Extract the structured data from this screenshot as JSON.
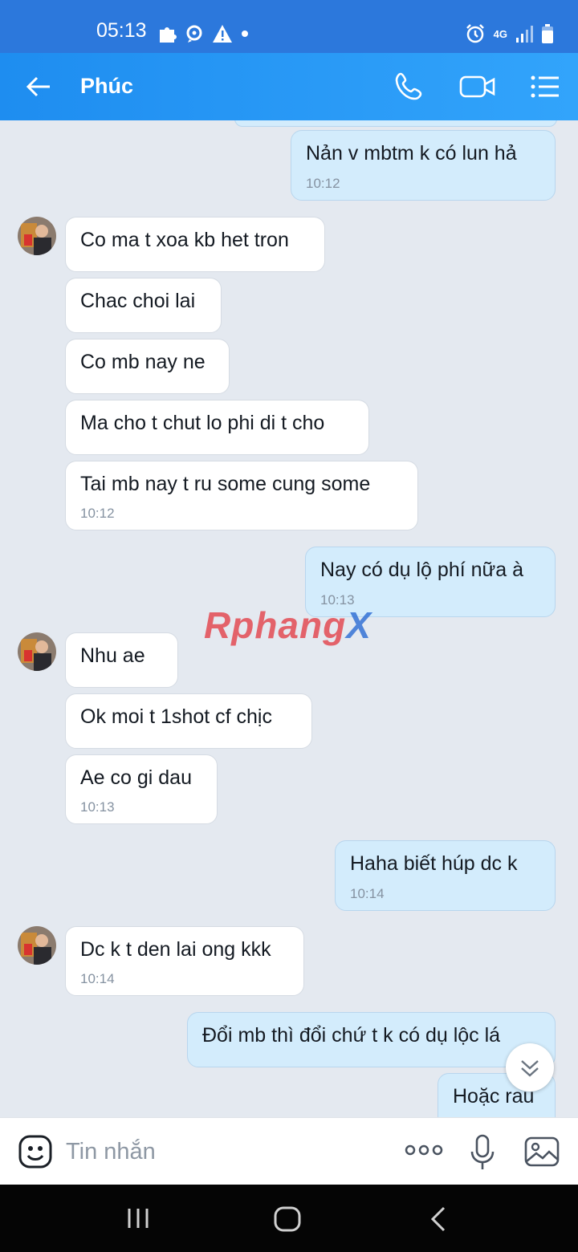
{
  "status": {
    "time": "05:13",
    "network": "4G"
  },
  "header": {
    "contact_name": "Phúc"
  },
  "messages": [
    {
      "text": "Nản v mbtm k có lun hả",
      "time": "10:12"
    },
    {
      "text": "Co ma t xoa kb het tron"
    },
    {
      "text": "Chac choi lai"
    },
    {
      "text": "Co mb nay ne"
    },
    {
      "text": "Ma cho t chut lo phi di t cho"
    },
    {
      "text": "Tai mb nay t ru some cung some",
      "time": "10:12"
    },
    {
      "text": "Nay có dụ lộ phí nữa à",
      "time": "10:13"
    },
    {
      "text": "Nhu ae"
    },
    {
      "text": "Ok moi t 1shot cf chịc"
    },
    {
      "text": "Ae co gi dau",
      "time": "10:13"
    },
    {
      "text": "Haha biết húp dc k",
      "time": "10:14"
    },
    {
      "text": "Dc k t den lai ong kkk",
      "time": "10:14"
    },
    {
      "text": "Đổi mb thì đổi chứ t k có dụ lộc lá"
    },
    {
      "text": "Hoặc rau"
    }
  ],
  "watermark": {
    "part1": "Rphang",
    "part2": "X"
  },
  "composer": {
    "placeholder": "Tin nhắn"
  },
  "colors": {
    "header_start": "#1e8df0",
    "header_end": "#32a4fb",
    "outgoing_bubble": "#d3ecfc",
    "incoming_bubble": "#ffffff",
    "chat_background": "#e4e9f0"
  },
  "icons": {
    "header": [
      "back-arrow-icon",
      "phone-icon",
      "video-call-icon",
      "menu-list-icon"
    ],
    "composer": [
      "emoji-icon",
      "more-dots-icon",
      "microphone-icon",
      "image-icon"
    ],
    "navigation": [
      "recent-apps-icon",
      "home-icon",
      "back-icon"
    ]
  }
}
